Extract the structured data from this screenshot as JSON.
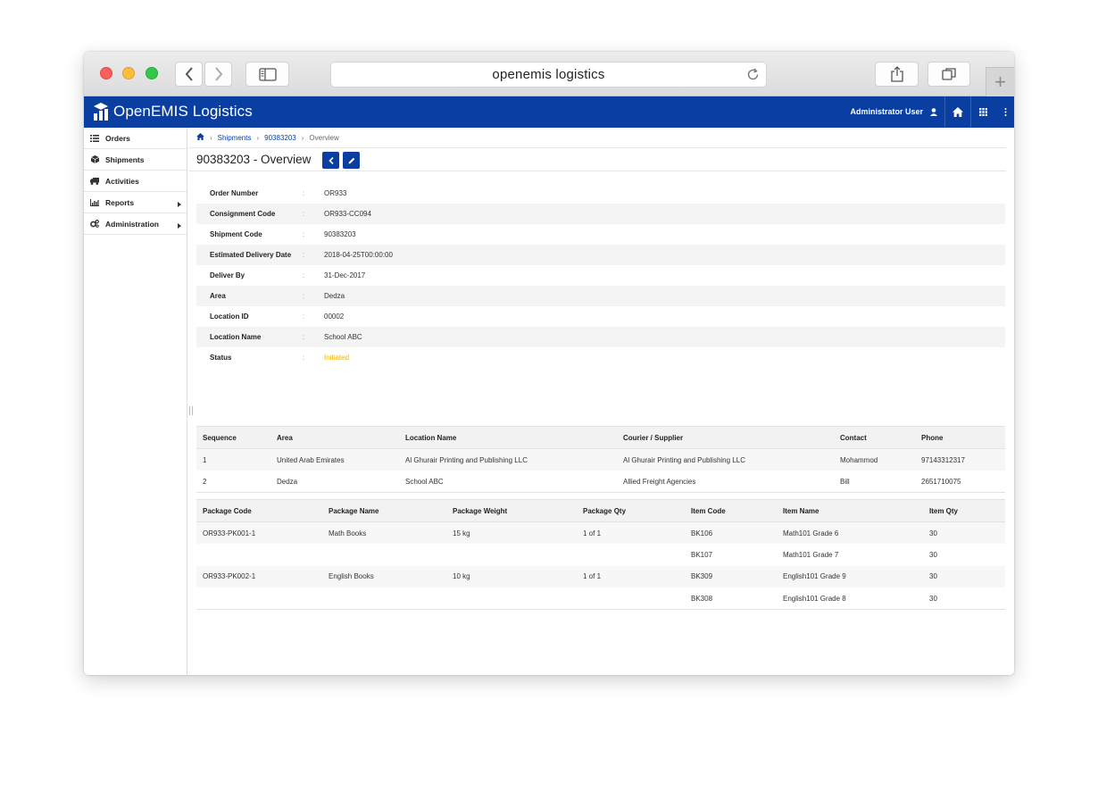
{
  "browser": {
    "address": "openemis logistics"
  },
  "app": {
    "brand": "OpenEMIS Logistics",
    "user": "Administrator User"
  },
  "sidebar": {
    "items": [
      {
        "label": "Orders",
        "icon": "list-icon"
      },
      {
        "label": "Shipments",
        "icon": "box-icon"
      },
      {
        "label": "Activities",
        "icon": "truck-icon"
      },
      {
        "label": "Reports",
        "icon": "bar-chart-icon"
      },
      {
        "label": "Administration",
        "icon": "cogs-icon"
      }
    ]
  },
  "breadcrumb": {
    "items": [
      "Shipments",
      "90383203",
      "Overview"
    ]
  },
  "page": {
    "title": "90383203 - Overview"
  },
  "details": [
    {
      "label": "Order Number",
      "value": "OR933"
    },
    {
      "label": "Consignment Code",
      "value": "OR933-CC094"
    },
    {
      "label": "Shipment Code",
      "value": "90383203"
    },
    {
      "label": "Estimated Delivery Date",
      "value": "2018-04-25T00:00:00"
    },
    {
      "label": "Deliver By",
      "value": "31-Dec-2017"
    },
    {
      "label": "Area",
      "value": "Dedza"
    },
    {
      "label": "Location ID",
      "value": "00002"
    },
    {
      "label": "Location Name",
      "value": "School ABC"
    },
    {
      "label": "Status",
      "value": "Initiated"
    }
  ],
  "route_table": {
    "headers": [
      "Sequence",
      "Area",
      "Location Name",
      "Courier / Supplier",
      "Contact",
      "Phone"
    ],
    "rows": [
      [
        "1",
        "United Arab Emirates",
        "Al Ghurair Printing and Publishing LLC",
        "Al Ghurair Printing and Publishing LLC",
        "Mohammod",
        "97143312317"
      ],
      [
        "2",
        "Dedza",
        "School ABC",
        "Allied Freight Agencies",
        "Bill",
        "2651710075"
      ]
    ]
  },
  "package_table": {
    "headers": [
      "Package Code",
      "Package Name",
      "Package Weight",
      "Package Qty",
      "Item Code",
      "Item Name",
      "Item Qty"
    ],
    "rows": [
      [
        "OR933-PK001-1",
        "Math Books",
        "15 kg",
        "1 of 1",
        "BK106",
        "Math101 Grade 6",
        "30"
      ],
      [
        "",
        "",
        "",
        "",
        "BK107",
        "Math101 Grade 7",
        "30"
      ],
      [
        "OR933-PK002-1",
        "English Books",
        "10 kg",
        "1 of 1",
        "BK309",
        "English101 Grade 9",
        "30"
      ],
      [
        "",
        "",
        "",
        "",
        "BK308",
        "English101 Grade 8",
        "30"
      ]
    ]
  },
  "colors": {
    "brand": "#0a3ea0",
    "status_initiated": "#f2b705"
  }
}
